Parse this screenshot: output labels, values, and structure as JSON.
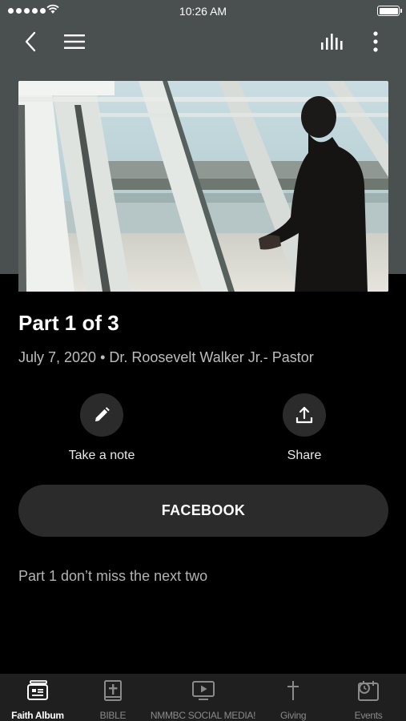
{
  "status_bar": {
    "time": "10:26 AM"
  },
  "nav": {
    "back_icon": "chevron-left-icon",
    "menu_icon": "hamburger-icon",
    "audio_icon": "audio-bars-icon",
    "more_icon": "more-vertical-icon"
  },
  "media": {
    "title": "Part 1 of 3",
    "meta": "July 7, 2020 • Dr. Roosevelt Walker Jr.- Pastor",
    "description": "Part 1 don’t miss the next two"
  },
  "actions": {
    "note_label": "Take a note",
    "share_label": "Share"
  },
  "link_button": {
    "label": "FACEBOOK"
  },
  "tabs": [
    {
      "label": "Faith Album",
      "icon": "album-icon",
      "active": true
    },
    {
      "label": "BIBLE",
      "icon": "bible-icon",
      "active": false
    },
    {
      "label": "NMMBC SOCIAL MEDIA!",
      "icon": "tv-play-icon",
      "active": false
    },
    {
      "label": "Giving",
      "icon": "cross-icon",
      "active": false
    },
    {
      "label": "Events",
      "icon": "calendar-clock-icon",
      "active": false
    }
  ],
  "colors": {
    "header_bg": "#4a4f4f",
    "page_bg": "#000000",
    "button_bg": "#2b2b2b",
    "tab_bar_bg": "#1f1f1f"
  }
}
